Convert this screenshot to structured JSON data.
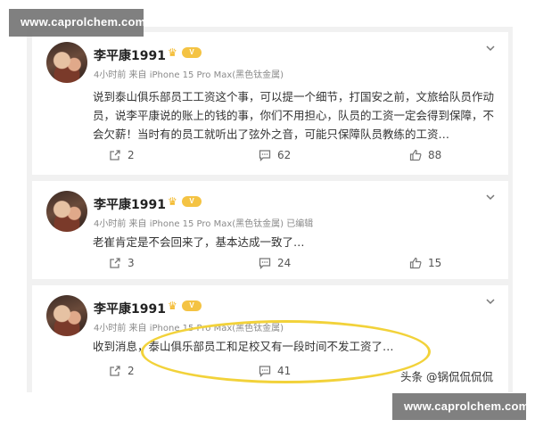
{
  "watermark": "www.caprolchem.com",
  "credit": "头条 @锅侃侃侃侃",
  "posts": [
    {
      "author": "李平康1991",
      "level": "V",
      "meta": "4小时前 来自 iPhone 15 Pro Max(黑色钛金属)",
      "edited": "",
      "text": "说到泰山俱乐部员工工资这个事，可以提一个细节，打国安之前，文旅给队员作动员，说李平康说的账上的钱的事，你们不用担心，队员的工资一定会得到保障，不会欠薪！当时有的员工就听出了弦外之音，可能只保障队员教练的工资…",
      "reposts": "2",
      "comments": "62",
      "likes": "88"
    },
    {
      "author": "李平康1991",
      "level": "V",
      "meta": "4小时前 来自 iPhone 15 Pro Max(黑色钛金属)",
      "edited": "已编辑",
      "text": "老崔肯定是不会回来了，基本达成一致了…",
      "reposts": "3",
      "comments": "24",
      "likes": "15"
    },
    {
      "author": "李平康1991",
      "level": "V",
      "meta": "4小时前 来自 iPhone 15 Pro Max(黑色钛金属)",
      "edited": "",
      "text": "收到消息，泰山俱乐部员工和足校又有一段时间不发工资了…",
      "reposts": "2",
      "comments": "41",
      "likes": ""
    }
  ],
  "colors": {
    "highlight": "#f2d23a",
    "vip": "#f4c343",
    "meta": "#8a8a8a"
  }
}
